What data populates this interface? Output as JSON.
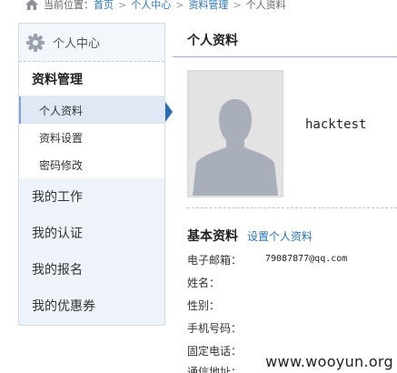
{
  "breadcrumb": {
    "prefix": "当前位置：",
    "items": [
      "首页",
      "个人中心",
      "资料管理",
      "个人资料"
    ],
    "separator": ">"
  },
  "sidebar": {
    "header": "个人中心",
    "section": "资料管理",
    "sub_items": [
      {
        "label": "个人资料",
        "active": true
      },
      {
        "label": "资料设置",
        "active": false
      },
      {
        "label": "密码修改",
        "active": false
      }
    ],
    "main_items": [
      "我的工作",
      "我的认证",
      "我的报名",
      "我的优惠券"
    ]
  },
  "main": {
    "title": "个人资料",
    "username": "hacktest",
    "basic_info_title": "基本资料",
    "edit_link": "设置个人资料",
    "fields": [
      {
        "label": "电子邮箱：",
        "value": "79087877@qq.com"
      },
      {
        "label": "姓名：",
        "value": ""
      },
      {
        "label": "性别：",
        "value": ""
      },
      {
        "label": "手机号码：",
        "value": ""
      },
      {
        "label": "固定电话：",
        "value": ""
      },
      {
        "label": "通信地址：",
        "value": ""
      }
    ]
  },
  "watermark": "www.wooyun.org",
  "colors": {
    "link": "#2a74b8",
    "sidebar_bg": "#eef3fa",
    "active_arrow": "#2a6bb2",
    "avatar_silhouette": "#a9afba"
  }
}
